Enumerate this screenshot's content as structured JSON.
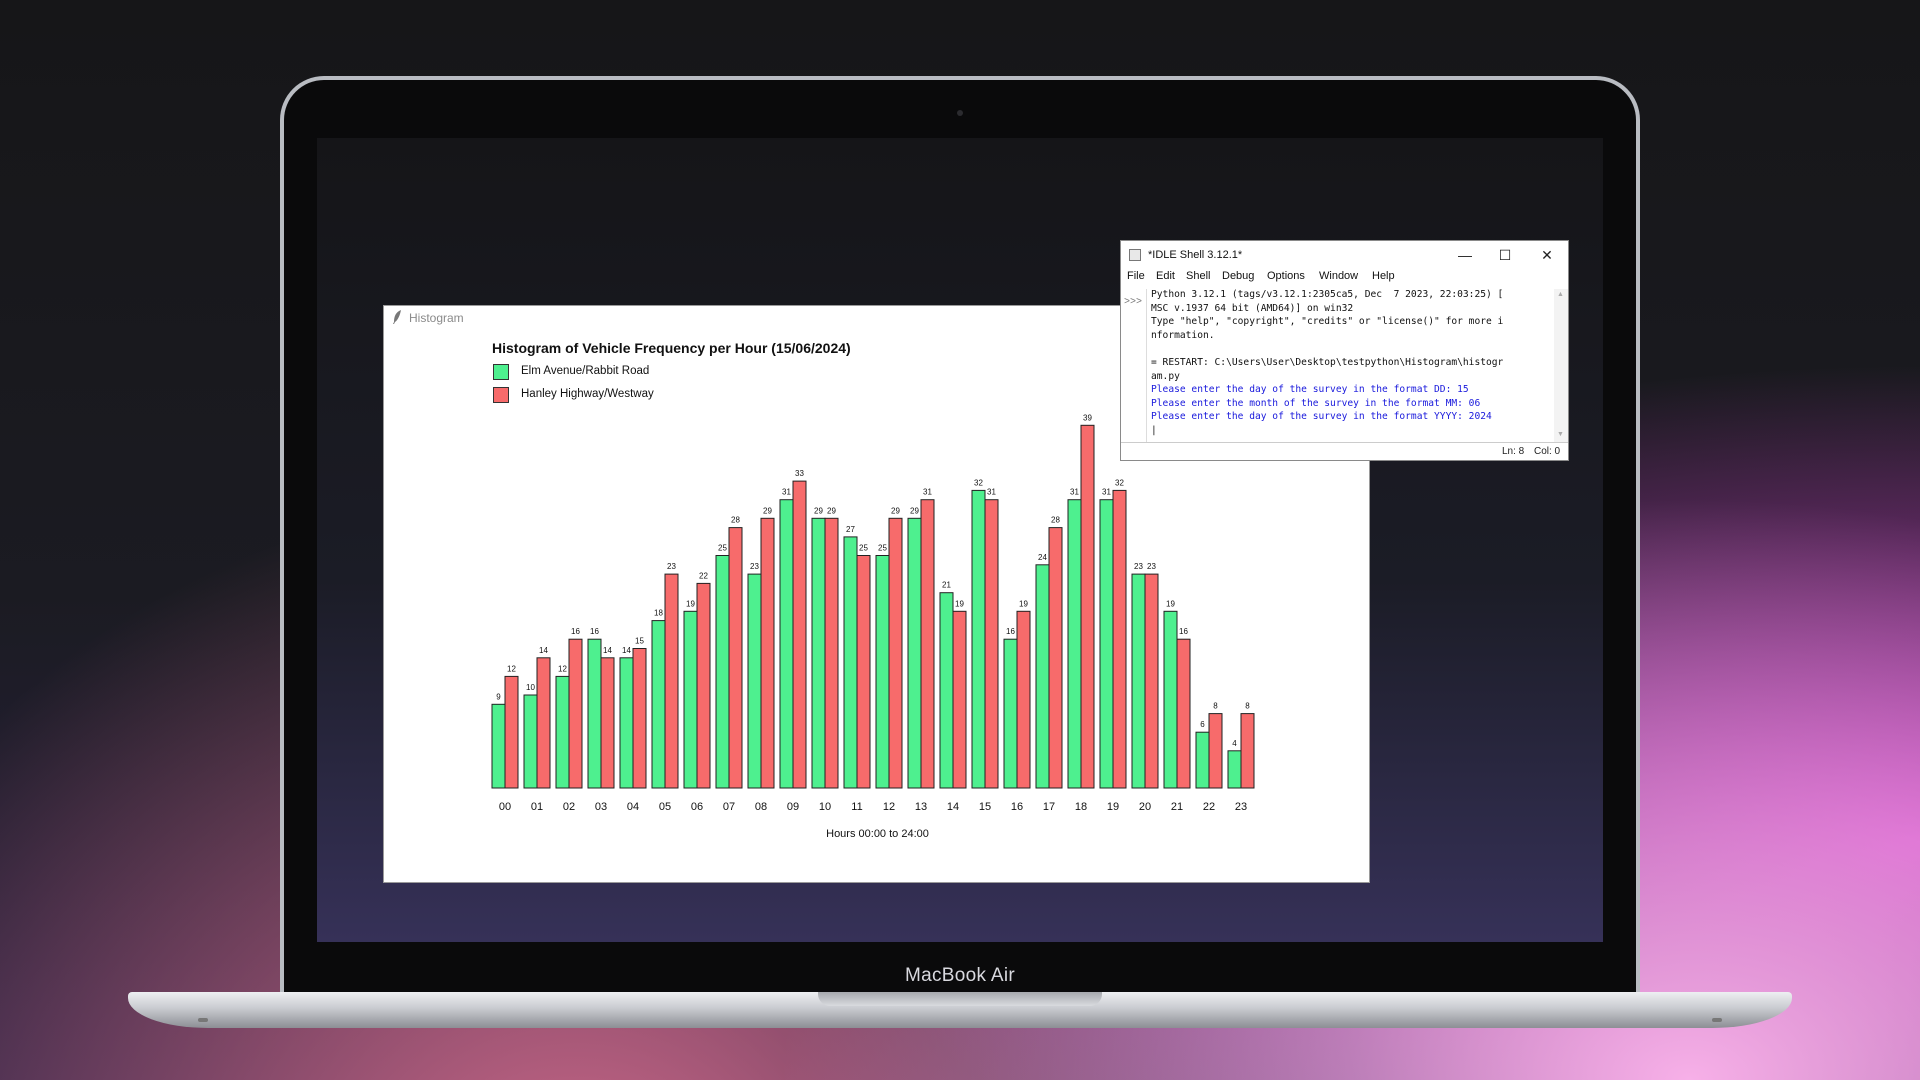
{
  "device": {
    "label": "MacBook Air"
  },
  "histogram_window": {
    "title": "Histogram",
    "legend": [
      {
        "name": "Elm Avenue/Rabbit Road",
        "color": "#4ef08f"
      },
      {
        "name": "Hanley Highway/Westway",
        "color": "#f76b6b"
      }
    ]
  },
  "chart_data": {
    "type": "bar",
    "title": "Histogram of Vehicle Frequency per Hour (15/06/2024)",
    "xlabel": "Hours 00:00 to 24:00",
    "ylabel": "",
    "categories": [
      "00",
      "01",
      "02",
      "03",
      "04",
      "05",
      "06",
      "07",
      "08",
      "09",
      "10",
      "11",
      "12",
      "13",
      "14",
      "15",
      "16",
      "17",
      "18",
      "19",
      "20",
      "21",
      "22",
      "23"
    ],
    "series": [
      {
        "name": "Elm Avenue/Rabbit Road",
        "color": "#4ef08f",
        "values": [
          9,
          10,
          12,
          16,
          14,
          18,
          19,
          25,
          23,
          31,
          29,
          27,
          25,
          29,
          21,
          32,
          16,
          24,
          31,
          31,
          23,
          19,
          6,
          4
        ]
      },
      {
        "name": "Hanley Highway/Westway",
        "color": "#f76b6b",
        "values": [
          12,
          14,
          16,
          14,
          15,
          23,
          22,
          28,
          29,
          33,
          29,
          25,
          29,
          31,
          19,
          31,
          19,
          28,
          39,
          32,
          23,
          16,
          8,
          8
        ]
      }
    ],
    "grid": false,
    "legend_position": "top-left"
  },
  "idle": {
    "title": "*IDLE Shell 3.12.1*",
    "window_controls": {
      "minimize": "—",
      "maximize": "☐",
      "close": "✕"
    },
    "menu": [
      "File",
      "Edit",
      "Shell",
      "Debug",
      "Options",
      "Window",
      "Help"
    ],
    "prompt": ">>>",
    "lines": [
      {
        "text": "Python 3.12.1 (tags/v3.12.1:2305ca5, Dec  7 2023, 22:03:25) [",
        "style": "normal"
      },
      {
        "text": "MSC v.1937 64 bit (AMD64)] on win32",
        "style": "normal"
      },
      {
        "text": "Type \"help\", \"copyright\", \"credits\" or \"license()\" for more i",
        "style": "normal"
      },
      {
        "text": "nformation.",
        "style": "normal"
      },
      {
        "text": "",
        "style": "normal"
      },
      {
        "text": "= RESTART: C:\\Users\\User\\Desktop\\testpython\\Histogram\\histogr",
        "style": "normal"
      },
      {
        "text": "am.py",
        "style": "normal"
      },
      {
        "text": "Please enter the day of the survey in the format DD: 15",
        "style": "blue"
      },
      {
        "text": "Please enter the month of the survey in the format MM: 06",
        "style": "blue"
      },
      {
        "text": "Please enter the day of the survey in the format YYYY: 2024",
        "style": "blue"
      },
      {
        "text": "|",
        "style": "normal"
      }
    ],
    "status": {
      "line": "Ln: 8",
      "col": "Col: 0"
    }
  }
}
